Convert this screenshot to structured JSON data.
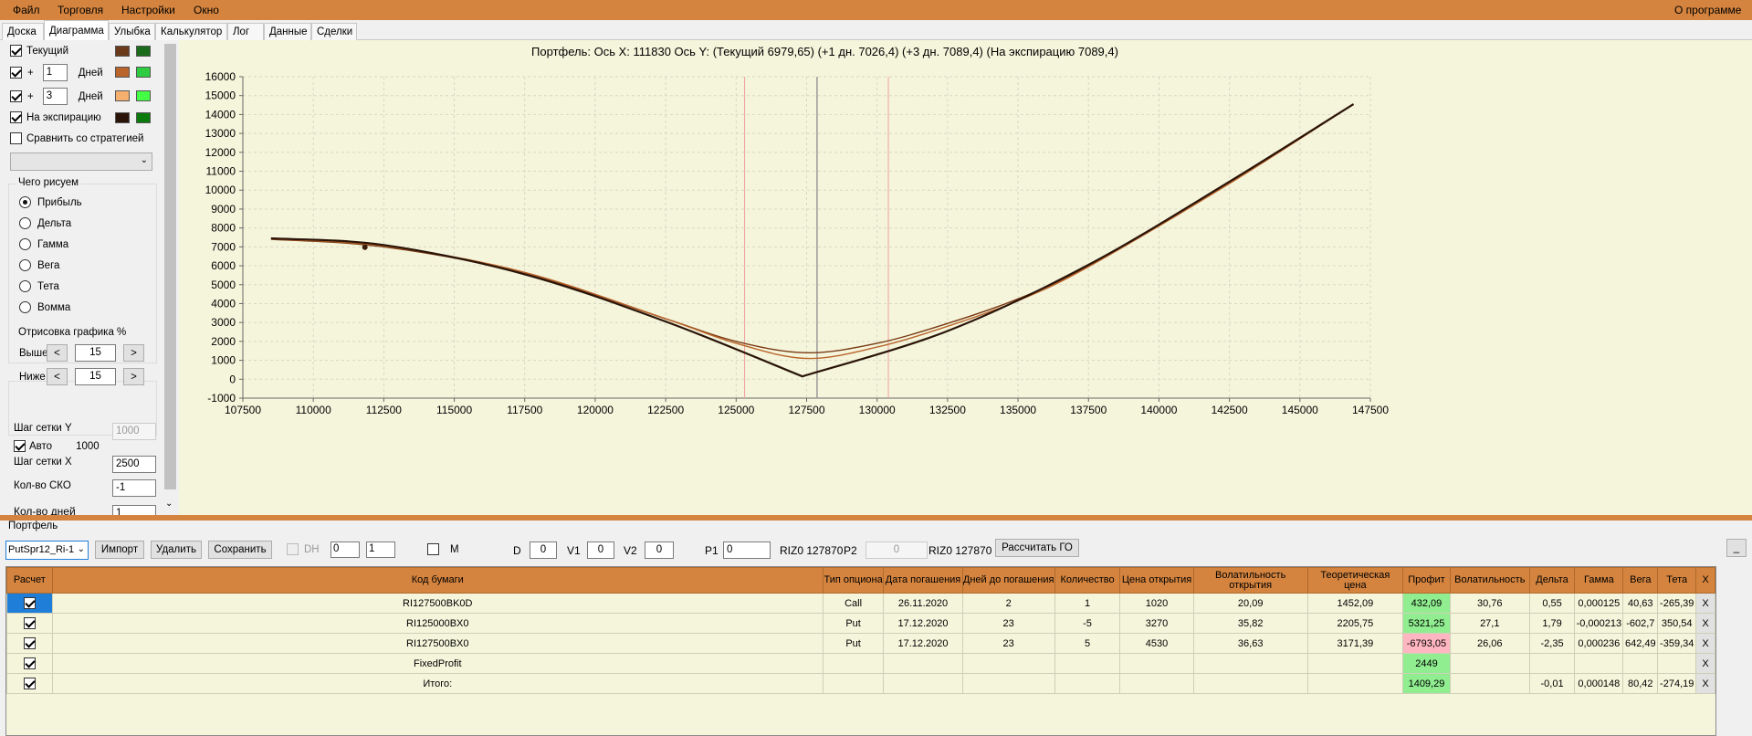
{
  "menu": {
    "file": "Файл",
    "trade": "Торговля",
    "settings": "Настройки",
    "window": "Окно",
    "about": "О программе"
  },
  "tabs": [
    "Доска",
    "Диаграмма",
    "Улыбка",
    "Калькулятор",
    "Лог",
    "Данные",
    "Сделки"
  ],
  "active_tab": "Диаграмма",
  "left": {
    "current_label": "Текущий",
    "plus": "+",
    "days1": "1",
    "days2": "3",
    "days_label": "Дней",
    "expiry_label": "На экспирацию",
    "compare_label": "Сравнить со стратегией",
    "what_title": "Чего рисуем",
    "radios": [
      "Прибыль",
      "Дельта",
      "Гамма",
      "Вега",
      "Тета",
      "Вомма"
    ],
    "draw_title": "Отрисовка графика %",
    "above_label": "Выше",
    "below_label": "Ниже",
    "above_val": "15",
    "below_val": "15",
    "prev": "<",
    "next": ">",
    "gridy_label": "Шаг сетки Y",
    "gridy_val": "1000",
    "auto_label": "Авто",
    "auto_val": "1000",
    "gridx_label": "Шаг сетки X",
    "gridx_val": "2500",
    "sko_label": "Кол-во СКО",
    "sko_val": "-1",
    "days_count_label": "Кол-во дней",
    "days_count_val": "1",
    "colors": {
      "cur_a": "#6b3a1a",
      "cur_b": "#1a6b1a",
      "d1_a": "#b8642a",
      "d1_b": "#2ecc40",
      "d3_a": "#f5b070",
      "d3_b": "#44ff44",
      "exp_a": "#2a1408",
      "exp_b": "#0a7a0a"
    }
  },
  "chart_data": {
    "type": "line",
    "title": "Портфель: Ось X: 111830 Ось Y:  (Текущий 6979,65)  (+1 дн. 7026,4)  (+3 дн. 7089,4)  (На экспирацию 7089,4)",
    "xlim": [
      107500,
      147500
    ],
    "ylim": [
      -1000,
      16000
    ],
    "xticks": [
      107500,
      110000,
      112500,
      115000,
      117500,
      120000,
      122500,
      125000,
      127500,
      130000,
      132500,
      135000,
      137500,
      140000,
      142500,
      145000,
      147500
    ],
    "yticks": [
      -1000,
      0,
      1000,
      2000,
      3000,
      4000,
      5000,
      6000,
      7000,
      8000,
      9000,
      10000,
      11000,
      12000,
      13000,
      14000,
      15000,
      16000
    ],
    "vlines": [
      {
        "x": 127870,
        "color": "#999999"
      },
      {
        "x": 125300,
        "color": "#f0a0a0"
      },
      {
        "x": 130400,
        "color": "#f0a0a0"
      }
    ],
    "marker": {
      "x": 111830,
      "y": 6980
    },
    "series": [
      {
        "color": "#2a1408",
        "x": [
          108500,
          112500,
          117500,
          122500,
          127350,
          132500,
          137500,
          142500,
          146900
        ],
        "y": [
          7450,
          7100,
          5550,
          3050,
          150,
          2550,
          6050,
          10450,
          14550
        ]
      },
      {
        "color": "#b8642a",
        "x": [
          108500,
          112500,
          117500,
          122500,
          125000,
          127500,
          130000,
          132500,
          135000,
          137500,
          142500,
          146900
        ],
        "y": [
          7420,
          7050,
          5650,
          3200,
          1900,
          1100,
          1700,
          2800,
          4150,
          5950,
          10350,
          14550
        ]
      },
      {
        "color": "#7a3a14",
        "x": [
          108500,
          112500,
          117500,
          122500,
          125000,
          127500,
          130000,
          132500,
          135000,
          137500,
          142500,
          146900
        ],
        "y": [
          7400,
          7000,
          5600,
          3200,
          2000,
          1400,
          1900,
          2950,
          4250,
          6000,
          10400,
          14550
        ]
      }
    ]
  },
  "portfolio": {
    "title": "Портфель",
    "name": "PutSpr12_Ri-1",
    "import": "Импорт",
    "delete": "Удалить",
    "save": "Сохранить",
    "dh": "DH",
    "s1": "0",
    "s2": "1",
    "m": "M",
    "d_label": "D",
    "d_val": "0",
    "v1_label": "V1",
    "v1_val": "0",
    "v2_label": "V2",
    "v2_val": "0",
    "p1_label": "P1",
    "p1_val": "0",
    "riz1": "RIZ0 127870",
    "p2_label": "P2",
    "p2_val": "0",
    "riz2": "RIZ0 127870",
    "calc_go": "Рассчитать ГО",
    "min": "_"
  },
  "table": {
    "headers": [
      "Расчет",
      "Код бумаги",
      "Тип опциона",
      "Дата погашения",
      "Дней до погашения",
      "Количество",
      "Цена открытия",
      "Волатильность открытия",
      "Теоретическая цена",
      "Профит",
      "Волатильность",
      "Дельта",
      "Гамма",
      "Вега",
      "Тета",
      "X"
    ],
    "rows": [
      {
        "code": "RI127500BK0D",
        "type": "Call",
        "date": "26.11.2020",
        "days": "2",
        "qty": "1",
        "price": "1020",
        "vol": "20,09",
        "theo": "1452,09",
        "profit": "432,09",
        "pc": "g",
        "v": "30,76",
        "delta": "0,55",
        "gamma": "0,000125",
        "vega": "40,63",
        "theta": "-265,39",
        "x": "X"
      },
      {
        "code": "RI125000BX0",
        "type": "Put",
        "date": "17.12.2020",
        "days": "23",
        "qty": "-5",
        "price": "3270",
        "vol": "35,82",
        "theo": "2205,75",
        "profit": "5321,25",
        "pc": "g",
        "v": "27,1",
        "delta": "1,79",
        "gamma": "-0,000213",
        "vega": "-602,7",
        "theta": "350,54",
        "x": "X"
      },
      {
        "code": "RI127500BX0",
        "type": "Put",
        "date": "17.12.2020",
        "days": "23",
        "qty": "5",
        "price": "4530",
        "vol": "36,63",
        "theo": "3171,39",
        "profit": "-6793,05",
        "pc": "r",
        "v": "26,06",
        "delta": "-2,35",
        "gamma": "0,000236",
        "vega": "642,49",
        "theta": "-359,34",
        "x": "X"
      },
      {
        "code": "FixedProfit",
        "type": "",
        "date": "",
        "days": "",
        "qty": "",
        "price": "",
        "vol": "",
        "theo": "",
        "profit": "2449",
        "pc": "g",
        "v": "",
        "delta": "",
        "gamma": "",
        "vega": "",
        "theta": "",
        "x": "X"
      },
      {
        "code": "Итого:",
        "type": "",
        "date": "",
        "days": "",
        "qty": "",
        "price": "",
        "vol": "",
        "theo": "",
        "profit": "1409,29",
        "pc": "g",
        "v": "",
        "delta": "-0,01",
        "gamma": "0,000148",
        "vega": "80,42",
        "theta": "-274,19",
        "x": "X"
      }
    ]
  }
}
